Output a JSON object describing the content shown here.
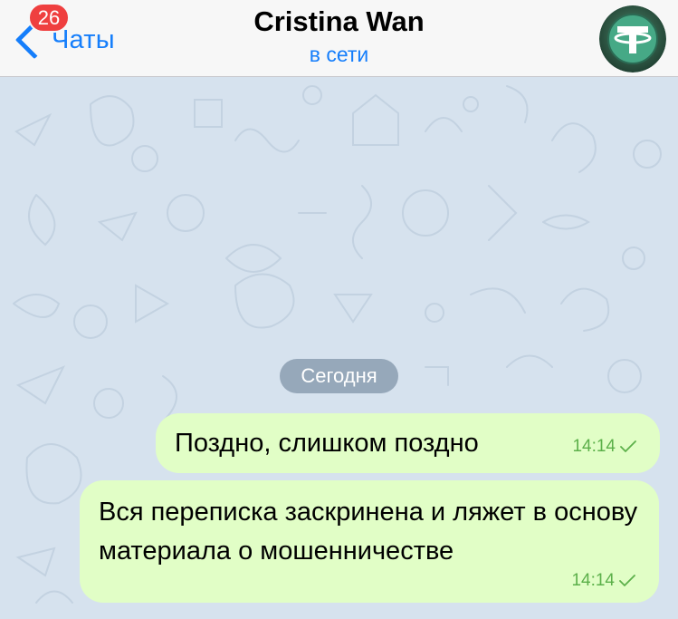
{
  "header": {
    "back_label": "Чаты",
    "unread_badge": "26",
    "title": "Cristina Wan",
    "status": "в сети",
    "avatar_icon": "tether-logo-avatar"
  },
  "chat": {
    "date_separator": "Сегодня",
    "messages": [
      {
        "text": "Поздно, слишком поздно",
        "time": "14:14",
        "status": "sent-check"
      },
      {
        "text": "Вся переписка заскринена и ляжет в основу материала о мошенничестве",
        "time": "14:14",
        "status": "sent-check"
      }
    ]
  },
  "colors": {
    "accent": "#157efb",
    "badge": "#ef3f3f",
    "outgoing_bubble": "#e1fec6",
    "time_text": "#5cb04a",
    "wallpaper": "#d6e2ee"
  }
}
